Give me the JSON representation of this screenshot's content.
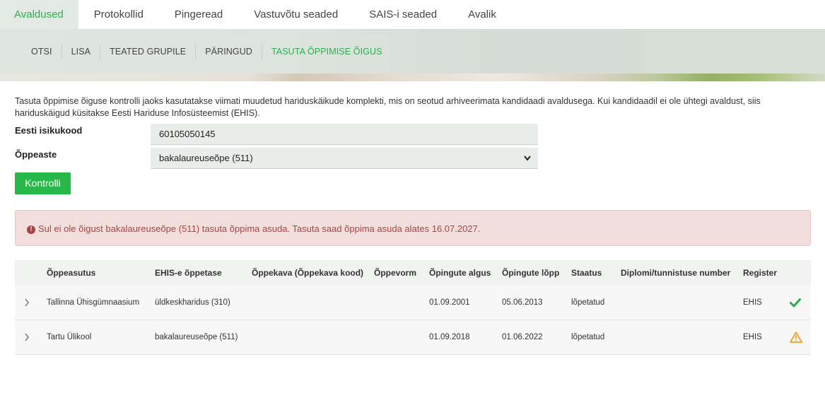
{
  "top_tabs": [
    "Avaldused",
    "Protokollid",
    "Pingeread",
    "Vastuvõtu seaded",
    "SAIS-i seaded",
    "Avalik"
  ],
  "sub_nav": [
    "OTSI",
    "LISA",
    "TEATED GRUPILE",
    "PÄRINGUD",
    "TASUTA ÕPPIMISE ÕIGUS"
  ],
  "info_text": "Tasuta õppimise õiguse kontrolli jaoks kasutatakse viimati muudetud hariduskäikude komplekti, mis on seotud arhiveerimata kandidaadi avaldusega. Kui kandidaadil ei ole ühtegi avaldust, siis hariduskäigud küsitakse Eesti Hariduse Infosüsteemist (EHIS).",
  "form": {
    "id_label": "Eesti isikukood",
    "id_value": "60105050145",
    "level_label": "Õppeaste",
    "level_value": "bakalaureuseõpe (511)",
    "submit_label": "Kontrolli"
  },
  "alert_text": "Sul ei ole õigust bakalaureuseõpe (511) tasuta õppima asuda. Tasuta saad õppima asuda alates 16.07.2027.",
  "table": {
    "columns": [
      "Õppeasutus",
      "EHIS-e õppetase",
      "Õppekava (Õppekava kood)",
      "Õppevorm",
      "Õpingute algus",
      "Õpingute lõpp",
      "Staatus",
      "Diplomi/tunnistuse number",
      "Register"
    ],
    "rows": [
      {
        "asutus": "Tallinna Ühisgümnaasium",
        "tase": "üldkeskharidus (310)",
        "kava": "",
        "vorm": "",
        "algus": "01.09.2001",
        "lopp": "05.06.2013",
        "staatus": "lõpetatud",
        "diplom": "",
        "register": "EHIS",
        "icon": "check-icon"
      },
      {
        "asutus": "Tartu Ülikool",
        "tase": "bakalaureuseõpe (511)",
        "kava": "",
        "vorm": "",
        "algus": "01.09.2018",
        "lopp": "01.06.2022",
        "staatus": "lõpetatud",
        "diplom": "",
        "register": "EHIS",
        "icon": "warning-icon"
      }
    ]
  },
  "colors": {
    "accent": "#2eae4e",
    "button": "#27b84a",
    "alert_text": "#a94442",
    "alert_bg": "#f3dede",
    "warning": "#f0a020",
    "check": "#2ea84a"
  }
}
